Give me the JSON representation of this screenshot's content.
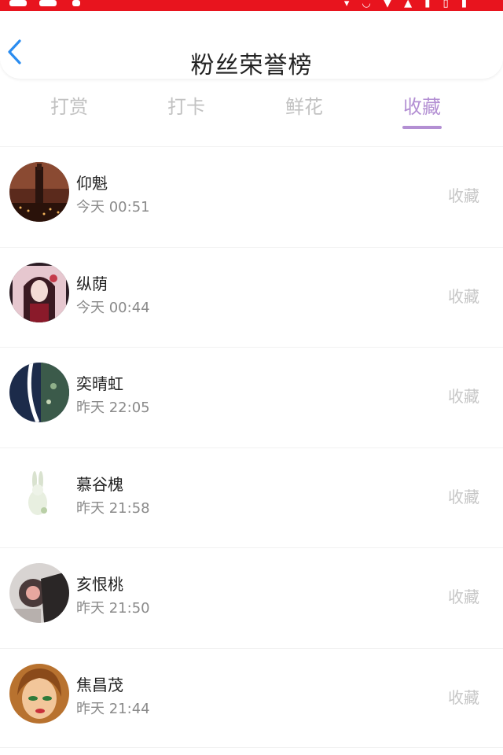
{
  "header": {
    "title": "粉丝荣誉榜"
  },
  "tabs": [
    {
      "label": "打赏",
      "active": false
    },
    {
      "label": "打卡",
      "active": false
    },
    {
      "label": "鲜花",
      "active": false
    },
    {
      "label": "收藏",
      "active": true
    }
  ],
  "colors": {
    "status_bar": "#e8141e",
    "active_tab": "#b38fd3",
    "muted_text": "#c2c2c2"
  },
  "list": [
    {
      "name": "仰魁",
      "time": "今天 00:51",
      "action": "收藏"
    },
    {
      "name": "纵荫",
      "time": "今天 00:44",
      "action": "收藏"
    },
    {
      "name": "奕晴虹",
      "time": "昨天 22:05",
      "action": "收藏"
    },
    {
      "name": "慕谷槐",
      "time": "昨天 21:58",
      "action": "收藏"
    },
    {
      "name": "亥恨桃",
      "time": "昨天 21:50",
      "action": "收藏"
    },
    {
      "name": "焦昌茂",
      "time": "昨天 21:44",
      "action": "收藏"
    }
  ]
}
